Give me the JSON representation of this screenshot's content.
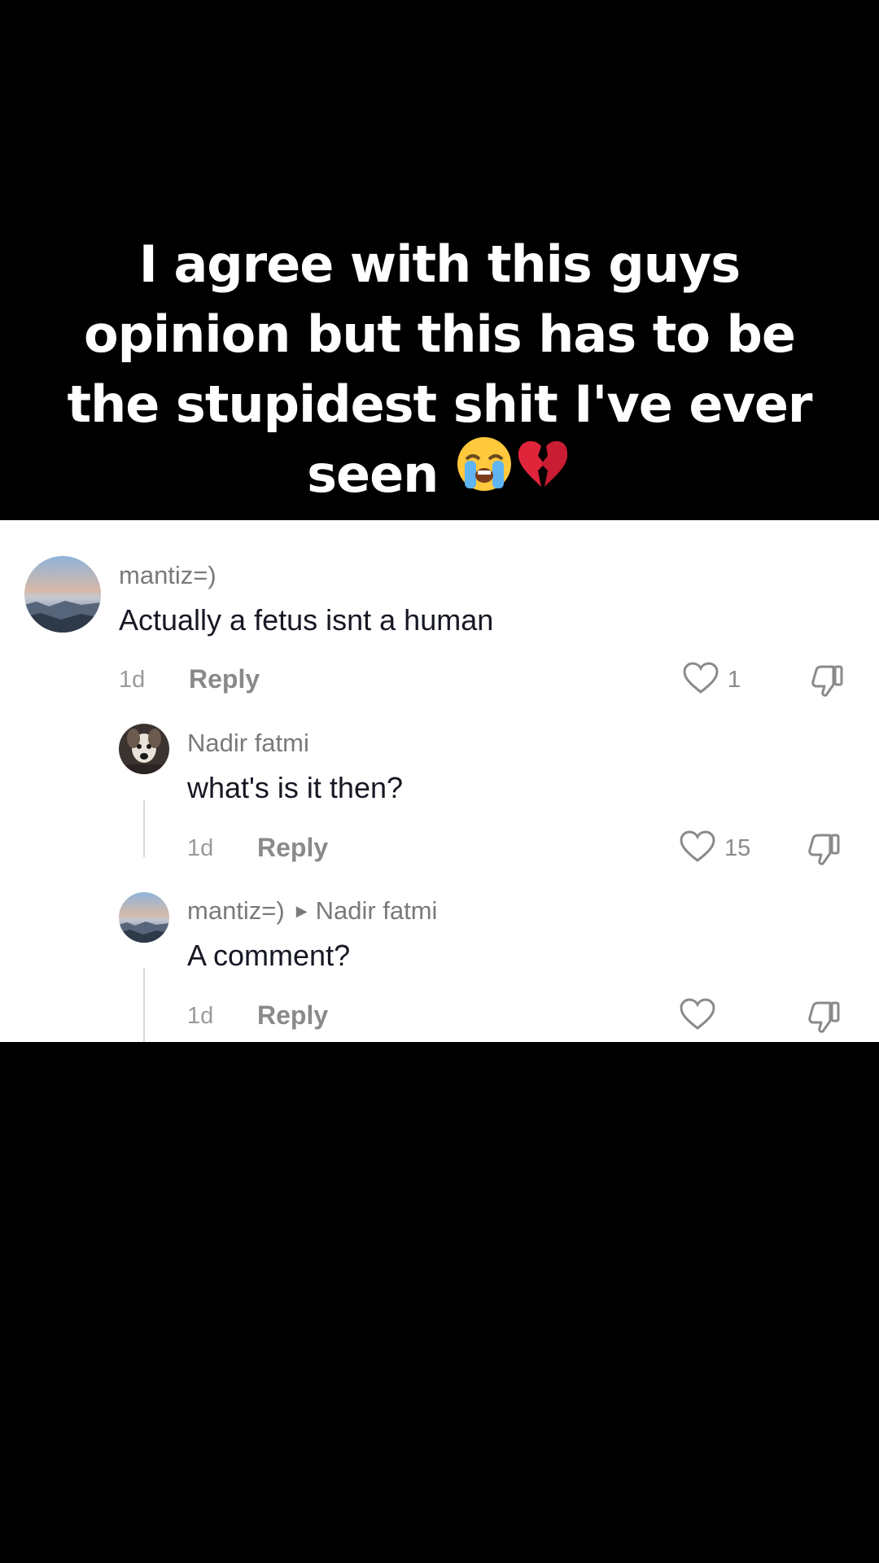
{
  "caption": {
    "lines": [
      "I agree with this guys",
      "opinion but this has to be",
      "the stupidest shit I've ever",
      "seen"
    ],
    "emojis": [
      "loudly-crying-face-emoji",
      "broken-heart-emoji"
    ]
  },
  "comments": [
    {
      "username": "mantiz=)",
      "text": "Actually a fetus isnt a human",
      "time": "1d",
      "reply_label": "Reply",
      "likes": "1",
      "avatar": "landscape-sky-avatar"
    },
    {
      "username": "Nadir fatmi",
      "text": "what's is it then?",
      "time": "1d",
      "reply_label": "Reply",
      "likes": "15",
      "avatar": "dog-photo-avatar"
    },
    {
      "username": "mantiz=)",
      "reply_to": "Nadir fatmi",
      "text": "A comment?",
      "time": "1d",
      "reply_label": "Reply",
      "likes": "",
      "avatar": "landscape-sky-avatar"
    }
  ],
  "colors": {
    "background": "#000000",
    "panel": "#ffffff",
    "primary_text": "#161823",
    "secondary_text": "#8a8a8a"
  }
}
